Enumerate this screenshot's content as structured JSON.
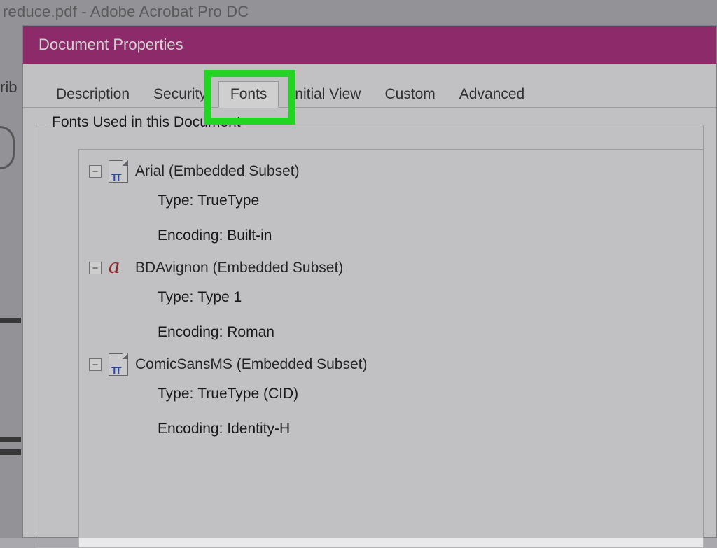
{
  "background": {
    "window_title": "reduce.pdf - Adobe Acrobat Pro DC",
    "frag_rib": "rib"
  },
  "dialog": {
    "title": "Document Properties",
    "tabs": {
      "description": "Description",
      "security": "Security",
      "fonts": "Fonts",
      "initial_view": "Initial View",
      "custom": "Custom",
      "advanced": "Advanced"
    },
    "group_label": "Fonts Used in this Document",
    "labels": {
      "type": "Type:",
      "encoding": "Encoding:"
    },
    "fonts": [
      {
        "name": "Arial (Embedded Subset)",
        "type": "TrueType",
        "encoding": "Built-in",
        "icon": "tt"
      },
      {
        "name": "BDAvignon (Embedded Subset)",
        "type": "Type 1",
        "encoding": "Roman",
        "icon": "a"
      },
      {
        "name": "ComicSansMS (Embedded Subset)",
        "type": "TrueType (CID)",
        "encoding": "Identity-H",
        "icon": "tt"
      }
    ]
  }
}
